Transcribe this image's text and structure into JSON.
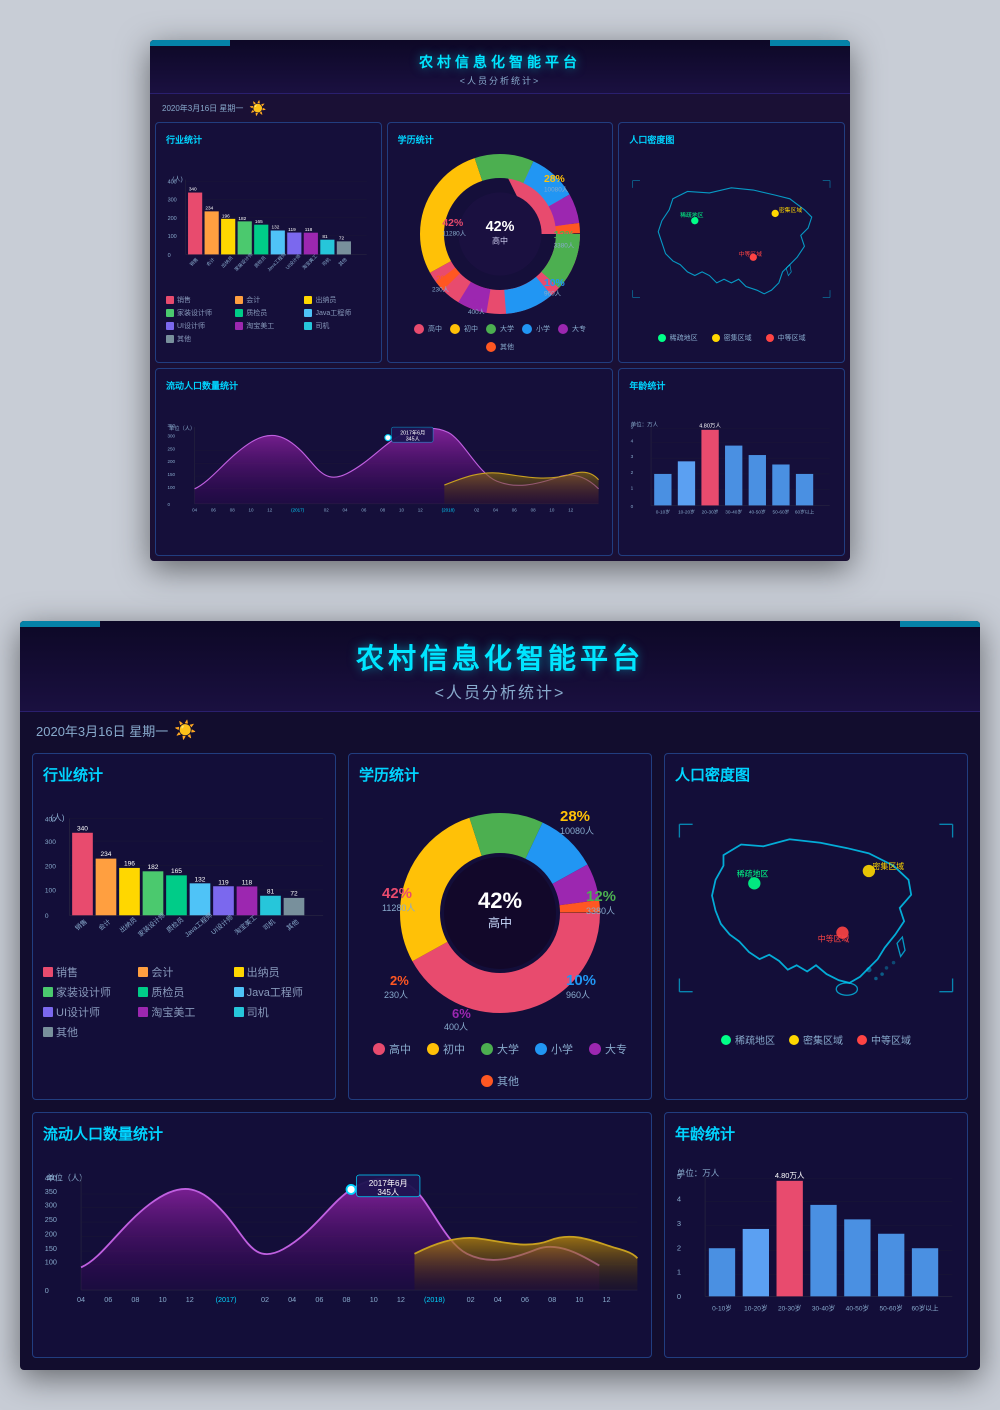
{
  "page": {
    "title": "农村信息化智能平台",
    "subtitle": "<人员分析统计>",
    "date": "2020年3月16日  星期一",
    "sun_emoji": "☀️"
  },
  "industry_chart": {
    "title": "行业统计",
    "y_label": "(人)",
    "bars": [
      {
        "label": "销售",
        "value": 340,
        "color": "#e84b6e"
      },
      {
        "label": "会计",
        "value": 234,
        "color": "#ff9f40"
      },
      {
        "label": "出纳员",
        "value": 196,
        "color": "#ffd700"
      },
      {
        "label": "家装设计师",
        "value": 182,
        "color": "#4bc96e"
      },
      {
        "label": "质检员",
        "value": 165,
        "color": "#00cc88"
      },
      {
        "label": "Java工程师",
        "value": 132,
        "color": "#4fc3f7"
      },
      {
        "label": "UI设计师",
        "value": 119,
        "color": "#7b68ee"
      },
      {
        "label": "淘宝美工",
        "value": 118,
        "color": "#9c27b0"
      },
      {
        "label": "司机",
        "value": 81,
        "color": "#26c6da"
      },
      {
        "label": "其他",
        "value": 72,
        "color": "#78909c"
      }
    ],
    "y_max": 400,
    "y_ticks": [
      0,
      100,
      200,
      300,
      400
    ]
  },
  "education_chart": {
    "title": "学历统计",
    "segments": [
      {
        "label": "高中",
        "percent": 42,
        "count": "11280人",
        "color": "#e84b6e"
      },
      {
        "label": "初中",
        "percent": 28,
        "count": "10080人",
        "color": "#ffc107"
      },
      {
        "label": "大学",
        "percent": 12,
        "count": "3380人",
        "color": "#4caf50"
      },
      {
        "label": "小学",
        "percent": 10,
        "count": "960人",
        "color": "#2196f3"
      },
      {
        "label": "大专",
        "percent": 6,
        "count": "400人",
        "color": "#9c27b0"
      },
      {
        "label": "其他",
        "percent": 2,
        "count": "230人",
        "color": "#ff5722"
      }
    ],
    "center_label": "高中",
    "center_percent": "42%"
  },
  "population_map": {
    "title": "人口密度图",
    "regions": [
      {
        "label": "稀疏地区",
        "color": "#00ff88"
      },
      {
        "label": "密集区域",
        "color": "#ffd700"
      },
      {
        "label": "中等区域",
        "color": "#ff4444"
      }
    ]
  },
  "floating_population": {
    "title": "流动人口数量统计",
    "y_label": "单位（人）",
    "y_ticks": [
      0,
      100,
      150,
      200,
      250,
      300,
      350,
      400
    ],
    "tooltip": {
      "date": "2017年6月",
      "value": "345人"
    },
    "x_labels": [
      "04",
      "06",
      "08",
      "10",
      "12",
      "(2017)",
      "02",
      "04",
      "06",
      "08",
      "10",
      "12",
      "(2018)",
      "02",
      "04",
      "06",
      "08",
      "10",
      "12"
    ]
  },
  "age_chart": {
    "title": "年龄统计",
    "y_label": "单位：万人",
    "highlight_label": "4.80万人",
    "bars": [
      {
        "label": "0-10岁",
        "value": 2.0,
        "color": "#4a90e2"
      },
      {
        "label": "10-20岁",
        "value": 2.8,
        "color": "#5ba0f2"
      },
      {
        "label": "20-30岁",
        "value": 4.8,
        "color": "#e84b6e"
      },
      {
        "label": "30-40岁",
        "value": 3.8,
        "color": "#4a90e2"
      },
      {
        "label": "40-50岁",
        "value": 3.2,
        "color": "#4a90e2"
      },
      {
        "label": "50-60岁",
        "value": 2.6,
        "color": "#4a90e2"
      },
      {
        "label": "60岁以上",
        "value": 2.0,
        "color": "#4a90e2"
      }
    ],
    "y_max": 5,
    "y_ticks": [
      1,
      2,
      3,
      4,
      5
    ]
  }
}
